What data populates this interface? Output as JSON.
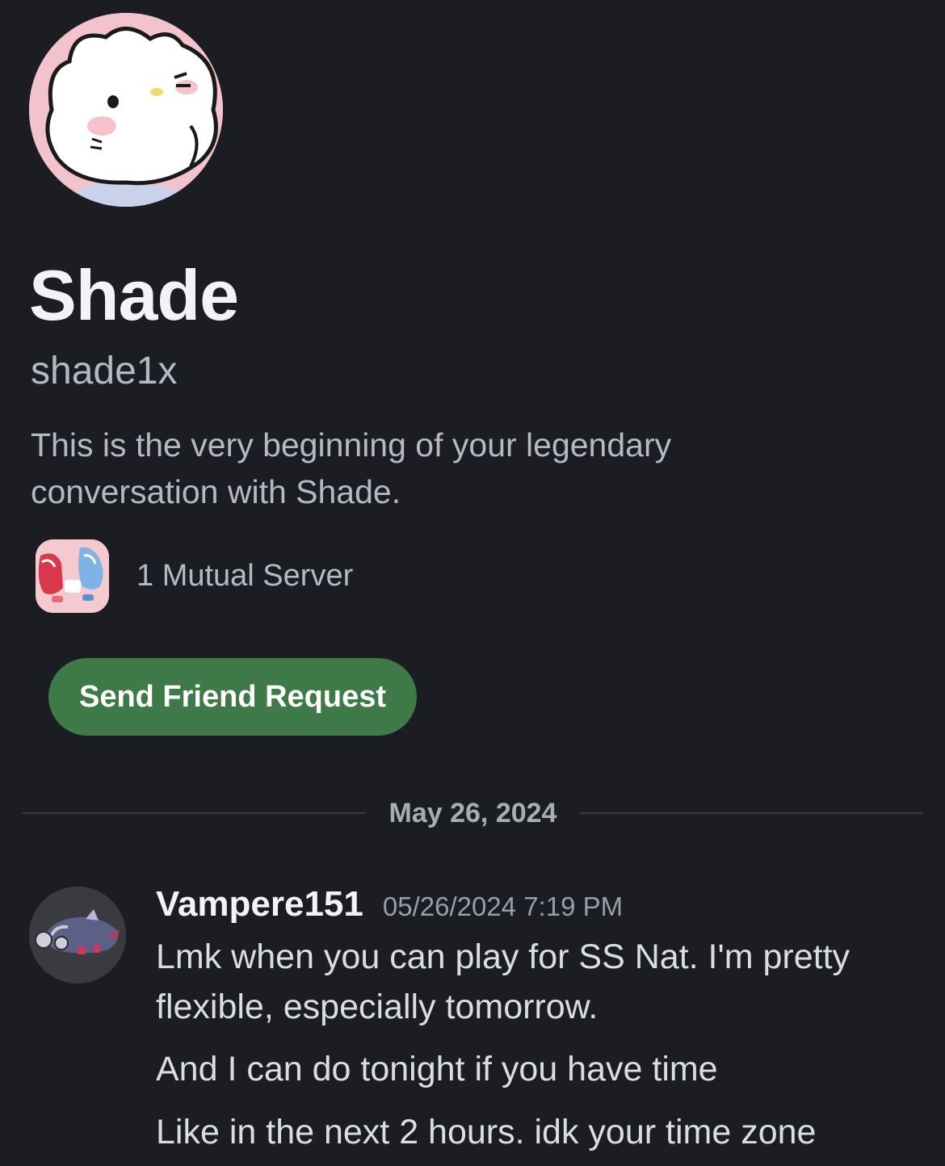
{
  "profile": {
    "display_name": "Shade",
    "username": "shade1x",
    "intro": "This is the very beginning of your legendary conversation with Shade.",
    "mutual_servers_label": "1 Mutual Server",
    "avatar_icon": "hello-kitty-style-cat-avatar",
    "server_icon": "pokemon-latias-latios-server-icon"
  },
  "actions": {
    "friend_request_label": "Send Friend Request",
    "friend_request_color": "#3d7a47"
  },
  "divider": {
    "date": "May 26, 2024"
  },
  "message": {
    "author": "Vampere151",
    "timestamp": "05/26/2024 7:19 PM",
    "avatar_icon": "pokemon-sprite-avatar",
    "lines": [
      "Lmk when you can play for SS Nat. I'm pretty",
      "flexible, especially tomorrow.",
      "And I can do tonight if you have time",
      "Like in the next 2 hours. idk your time zone"
    ]
  },
  "theme": {
    "background": "#1c1d22",
    "primary_text": "#f2f3f5",
    "secondary_text": "#b5bac1"
  }
}
